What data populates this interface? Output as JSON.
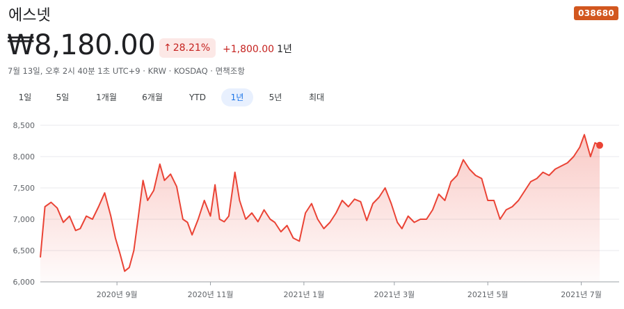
{
  "header": {
    "company_name": "에스넷",
    "ticker_badge": "038680",
    "price": "₩8,180.00",
    "change_percent": "28.21%",
    "change_arrow": "↑",
    "change_abs": "+1,800.00",
    "change_period": "1년",
    "meta": "7월 13일, 오후 2시 40분 1초 UTC+9 · KRW · KOSDAQ · 면책조항"
  },
  "colors": {
    "up": "#c5221f",
    "line": "#ea4335",
    "badge": "#d2571f",
    "tab_active": "#1a73e8"
  },
  "tabs": [
    {
      "label": "1일",
      "active": false
    },
    {
      "label": "5일",
      "active": false
    },
    {
      "label": "1개월",
      "active": false
    },
    {
      "label": "6개월",
      "active": false
    },
    {
      "label": "YTD",
      "active": false
    },
    {
      "label": "1년",
      "active": true
    },
    {
      "label": "5년",
      "active": false
    },
    {
      "label": "최대",
      "active": false
    }
  ],
  "chart_data": {
    "type": "area",
    "ylim": [
      6000,
      8500
    ],
    "yticks": [
      6000,
      6500,
      7000,
      7500,
      8000,
      8500
    ],
    "ytick_labels": [
      "6,000",
      "6,500",
      "7,000",
      "7,500",
      "8,000",
      "8,500"
    ],
    "xticks": [
      {
        "x": "2020-09-01",
        "label": "2020년 9월"
      },
      {
        "x": "2020-11-01",
        "label": "2020년 11월"
      },
      {
        "x": "2021-01-01",
        "label": "2021년 1월"
      },
      {
        "x": "2021-03-01",
        "label": "2021년 3월"
      },
      {
        "x": "2021-05-01",
        "label": "2021년 5월"
      },
      {
        "x": "2021-07-01",
        "label": "2021년 7월"
      }
    ],
    "xlim": [
      "2020-07-13",
      "2021-07-13"
    ],
    "grid": true,
    "series": [
      {
        "points": [
          [
            "2020-07-13",
            6390
          ],
          [
            "2020-07-16",
            7200
          ],
          [
            "2020-07-20",
            7270
          ],
          [
            "2020-07-24",
            7180
          ],
          [
            "2020-07-28",
            6950
          ],
          [
            "2020-08-01",
            7050
          ],
          [
            "2020-08-05",
            6820
          ],
          [
            "2020-08-08",
            6850
          ],
          [
            "2020-08-12",
            7050
          ],
          [
            "2020-08-16",
            7000
          ],
          [
            "2020-08-20",
            7200
          ],
          [
            "2020-08-24",
            7420
          ],
          [
            "2020-08-28",
            7050
          ],
          [
            "2020-08-31",
            6700
          ],
          [
            "2020-09-03",
            6450
          ],
          [
            "2020-09-06",
            6170
          ],
          [
            "2020-09-09",
            6230
          ],
          [
            "2020-09-12",
            6500
          ],
          [
            "2020-09-15",
            7050
          ],
          [
            "2020-09-18",
            7620
          ],
          [
            "2020-09-21",
            7300
          ],
          [
            "2020-09-25",
            7460
          ],
          [
            "2020-09-29",
            7880
          ],
          [
            "2020-10-02",
            7620
          ],
          [
            "2020-10-06",
            7720
          ],
          [
            "2020-10-10",
            7520
          ],
          [
            "2020-10-14",
            7000
          ],
          [
            "2020-10-17",
            6950
          ],
          [
            "2020-10-20",
            6750
          ],
          [
            "2020-10-24",
            7000
          ],
          [
            "2020-10-28",
            7300
          ],
          [
            "2020-11-01",
            7050
          ],
          [
            "2020-11-04",
            7550
          ],
          [
            "2020-11-07",
            7000
          ],
          [
            "2020-11-10",
            6960
          ],
          [
            "2020-11-13",
            7050
          ],
          [
            "2020-11-17",
            7750
          ],
          [
            "2020-11-20",
            7300
          ],
          [
            "2020-11-24",
            7000
          ],
          [
            "2020-11-28",
            7100
          ],
          [
            "2020-12-02",
            6960
          ],
          [
            "2020-12-06",
            7150
          ],
          [
            "2020-12-10",
            7000
          ],
          [
            "2020-12-13",
            6950
          ],
          [
            "2020-12-17",
            6800
          ],
          [
            "2020-12-21",
            6900
          ],
          [
            "2020-12-25",
            6700
          ],
          [
            "2020-12-29",
            6650
          ],
          [
            "2021-01-02",
            7100
          ],
          [
            "2021-01-06",
            7250
          ],
          [
            "2021-01-10",
            7000
          ],
          [
            "2021-01-14",
            6850
          ],
          [
            "2021-01-18",
            6950
          ],
          [
            "2021-01-22",
            7100
          ],
          [
            "2021-01-26",
            7300
          ],
          [
            "2021-01-30",
            7200
          ],
          [
            "2021-02-03",
            7320
          ],
          [
            "2021-02-07",
            7280
          ],
          [
            "2021-02-11",
            6980
          ],
          [
            "2021-02-15",
            7250
          ],
          [
            "2021-02-19",
            7350
          ],
          [
            "2021-02-23",
            7500
          ],
          [
            "2021-02-27",
            7250
          ],
          [
            "2021-03-03",
            6950
          ],
          [
            "2021-03-06",
            6850
          ],
          [
            "2021-03-10",
            7050
          ],
          [
            "2021-03-14",
            6950
          ],
          [
            "2021-03-18",
            7000
          ],
          [
            "2021-03-22",
            7000
          ],
          [
            "2021-03-26",
            7150
          ],
          [
            "2021-03-30",
            7400
          ],
          [
            "2021-04-03",
            7300
          ],
          [
            "2021-04-07",
            7600
          ],
          [
            "2021-04-11",
            7700
          ],
          [
            "2021-04-15",
            7950
          ],
          [
            "2021-04-19",
            7800
          ],
          [
            "2021-04-23",
            7700
          ],
          [
            "2021-04-27",
            7650
          ],
          [
            "2021-05-01",
            7300
          ],
          [
            "2021-05-05",
            7300
          ],
          [
            "2021-05-09",
            7000
          ],
          [
            "2021-05-13",
            7150
          ],
          [
            "2021-05-17",
            7200
          ],
          [
            "2021-05-21",
            7300
          ],
          [
            "2021-05-25",
            7450
          ],
          [
            "2021-05-29",
            7600
          ],
          [
            "2021-06-02",
            7650
          ],
          [
            "2021-06-06",
            7750
          ],
          [
            "2021-06-10",
            7700
          ],
          [
            "2021-06-14",
            7800
          ],
          [
            "2021-06-18",
            7850
          ],
          [
            "2021-06-22",
            7900
          ],
          [
            "2021-06-26",
            8000
          ],
          [
            "2021-06-30",
            8150
          ],
          [
            "2021-07-03",
            8350
          ],
          [
            "2021-07-07",
            8000
          ],
          [
            "2021-07-10",
            8220
          ],
          [
            "2021-07-13",
            8180
          ]
        ]
      }
    ]
  }
}
